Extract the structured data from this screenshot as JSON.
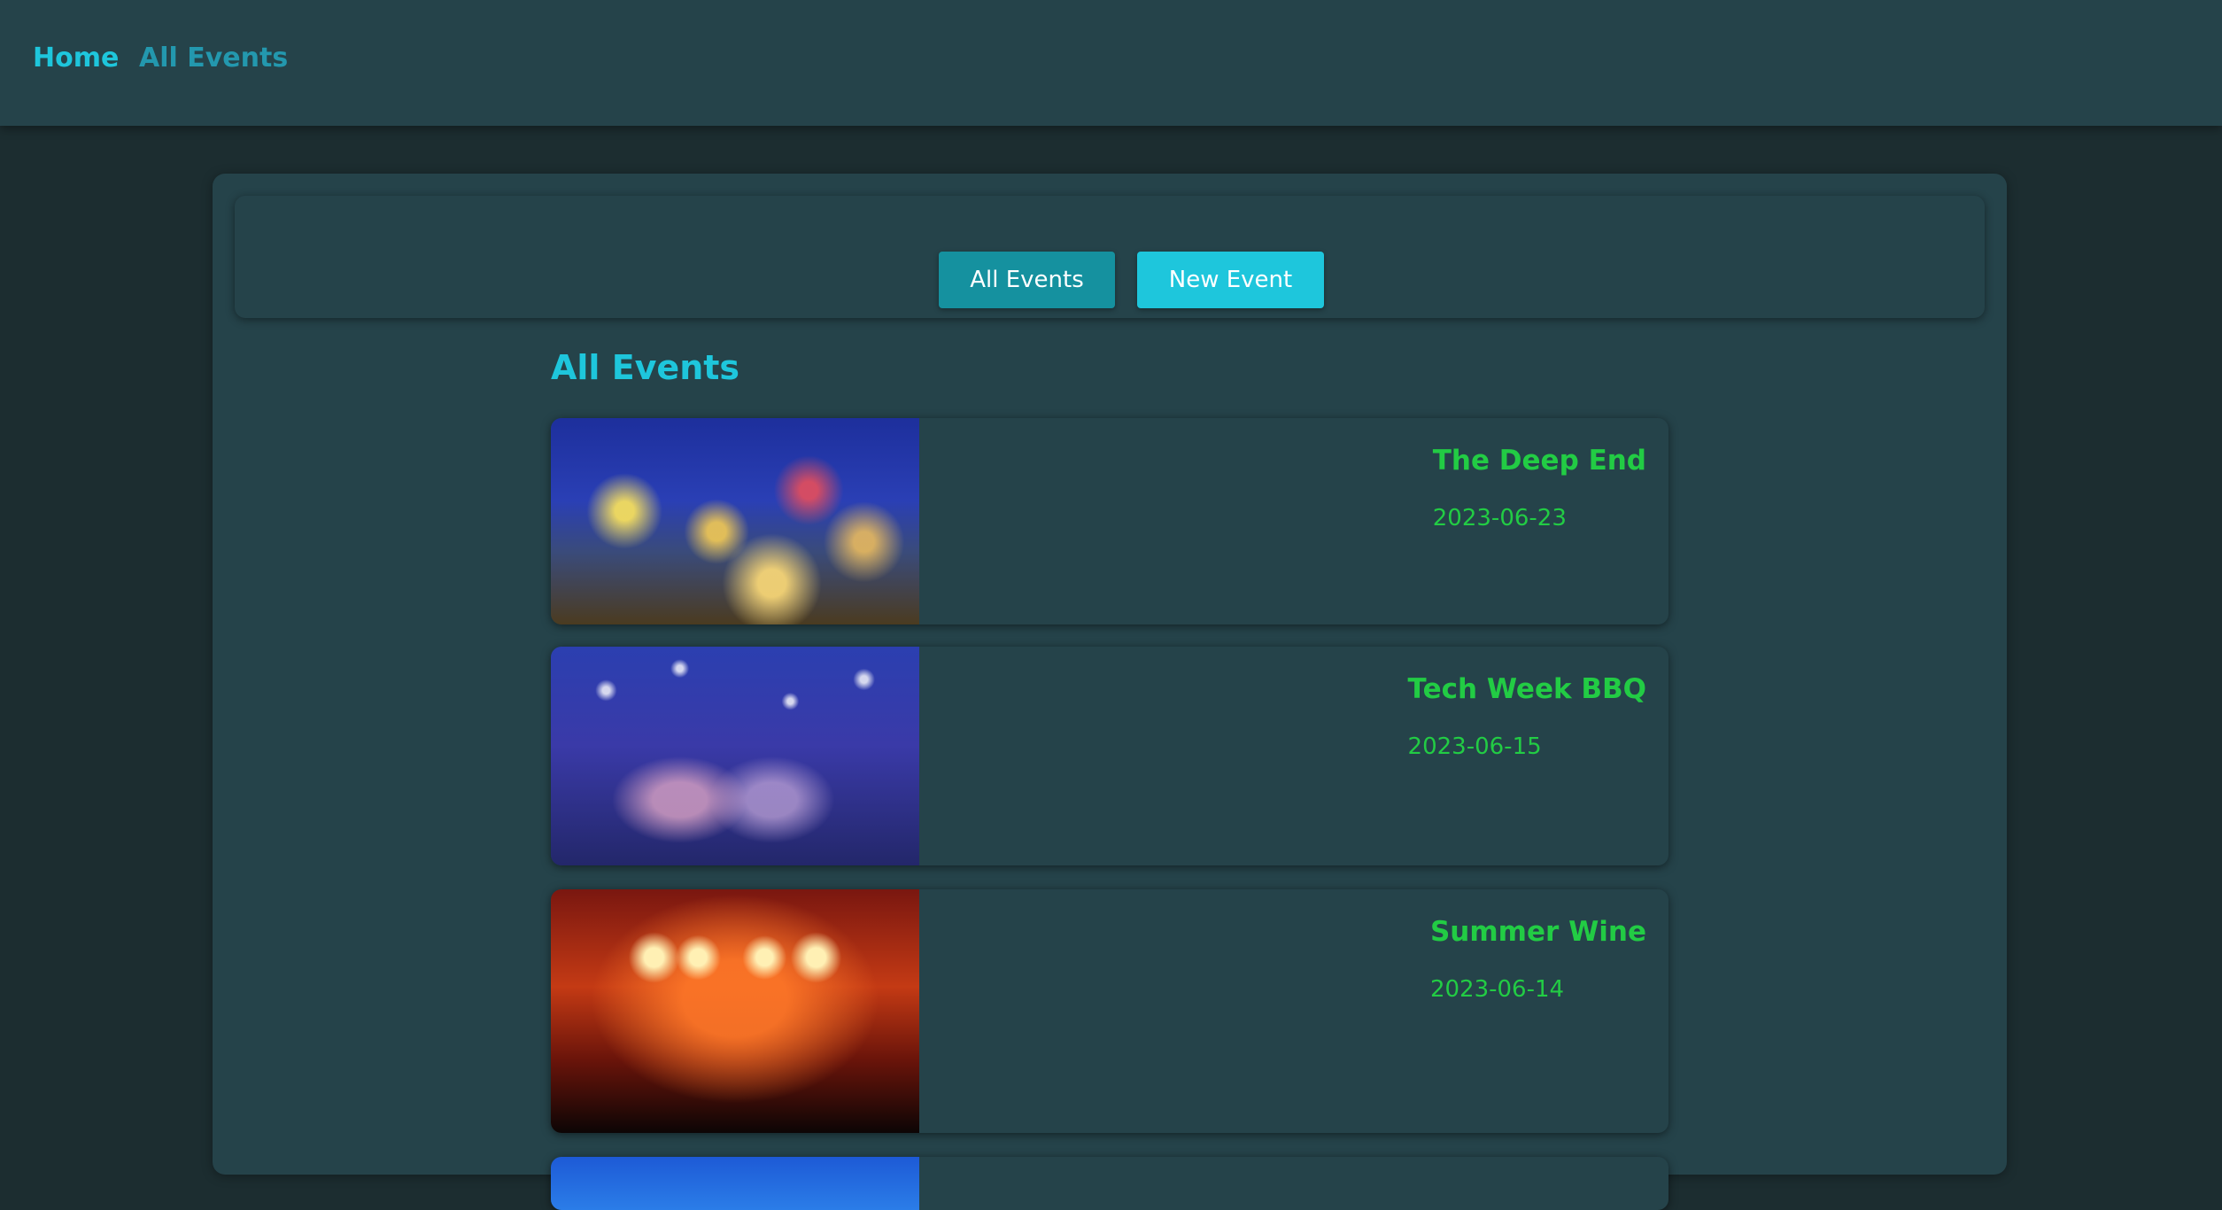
{
  "nav": {
    "home_label": "Home",
    "all_events_label": "All Events"
  },
  "toolbar": {
    "all_events_button": "All Events",
    "new_event_button": "New Event"
  },
  "section": {
    "title": "All Events"
  },
  "events": [
    {
      "name": "The Deep End",
      "date": "2023-06-23",
      "image": "palm-trees-holiday-lights-photo"
    },
    {
      "name": "Tech Week BBQ",
      "date": "2023-06-15",
      "image": "crowd-dancing-party-photo"
    },
    {
      "name": "Summer Wine",
      "date": "2023-06-14",
      "image": "concert-stage-lights-photo"
    },
    {
      "image": "blue-event-photo"
    }
  ],
  "colors": {
    "page_background": "#1c2d30",
    "panel": "#25434a",
    "accent": "#1ec6dc",
    "accent_dark": "#15919f",
    "event_text": "#22cc44"
  }
}
